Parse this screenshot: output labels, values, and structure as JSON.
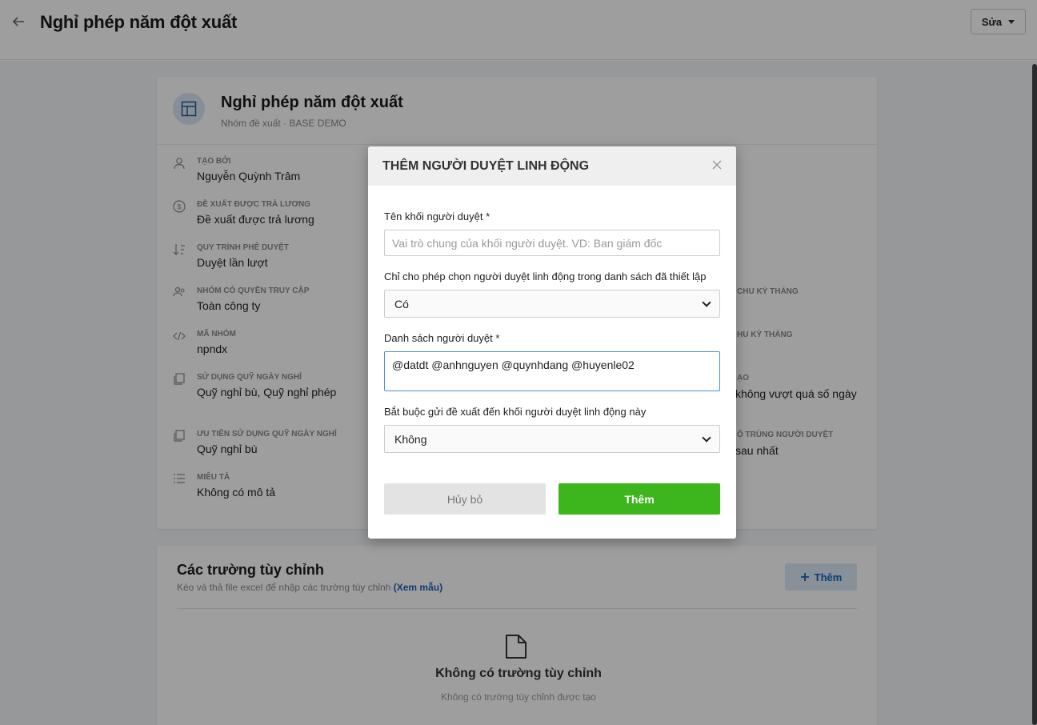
{
  "header": {
    "back_icon": "arrow-left-icon",
    "title": "Nghỉ phép năm đột xuất",
    "edit_label": "Sửa"
  },
  "group": {
    "title": "Nghỉ phép năm đột xuất",
    "subtitle": "Nhóm đề xuất · BASE DEMO",
    "info": [
      {
        "label": "TẠO BỞI",
        "value": "Nguyễn Quỳnh Trâm",
        "icon": "user-icon"
      },
      {
        "label": "ĐỀ XUẤT ĐƯỢC TRẢ LƯƠNG",
        "value": "Đề xuất được trả lương",
        "icon": "dollar-icon"
      },
      {
        "label": "QUY TRÌNH PHÊ DUYỆT",
        "value": "Duyệt lần lượt",
        "icon": "sort-icon"
      },
      {
        "label": "NHÓM CÓ QUYỀN TRUY CẬP",
        "value": "Toàn công ty",
        "icon": "users-icon"
      },
      {
        "label": "MÃ NHÓM",
        "value": "npndx",
        "icon": "code-icon"
      },
      {
        "label": "SỬ DỤNG QUỸ NGÀY NGHỈ",
        "value": "Quỹ nghỉ bù, Quỹ nghỉ phép",
        "icon": "copy-icon"
      },
      {
        "label": "ƯU TIÊN SỬ DỤNG QUỸ NGÀY NGHỈ",
        "value": "Quỹ nghỉ bù",
        "icon": "copy-icon"
      },
      {
        "label": "MIÊU TẢ",
        "value": "Không có mô tả",
        "icon": "list-icon"
      }
    ],
    "right_fragments": {
      "r1_label": "CHU KỲ THÁNG",
      "r2_label": "HU KỲ THÁNG",
      "r3_label": "ẠO",
      "r3_value": "không vượt quá số ngày",
      "r4_label": "Ố TRÙNG NGƯỜI DUYỆT",
      "r4_value": "sau nhất"
    }
  },
  "custom_fields": {
    "title": "Các trường tùy chỉnh",
    "subtitle": "Kéo và thả file excel để nhập các trường tùy chỉnh",
    "sample_link": "(Xem mẫu)",
    "add_label": "Thêm",
    "empty_title": "Không có trường tùy chỉnh",
    "empty_subtitle": "Không có trường tùy chỉnh được tạo"
  },
  "modal": {
    "title": "THÊM NGƯỜI DUYỆT LINH ĐỘNG",
    "close_icon": "close-icon",
    "block_name_label": "Tên khối người duyệt *",
    "block_name_placeholder": "Vai trò chung của khối người duyệt. VD: Ban giám đốc",
    "block_name_value": "",
    "restrict_label": "Chỉ cho phép chọn người duyệt linh động trong danh sách đã thiết lập",
    "restrict_value": "Có",
    "approvers_label": "Danh sách người duyệt *",
    "approvers_value": "@datdt @anhnguyen @quynhdang @huyenle02",
    "required_label": "Bắt buộc gửi đề xuất đến khối người duyệt linh động này",
    "required_value": "Không",
    "cancel_label": "Hủy bỏ",
    "submit_label": "Thêm",
    "colors": {
      "submit": "#3db51d",
      "focus_border": "#4a8fdb"
    }
  }
}
